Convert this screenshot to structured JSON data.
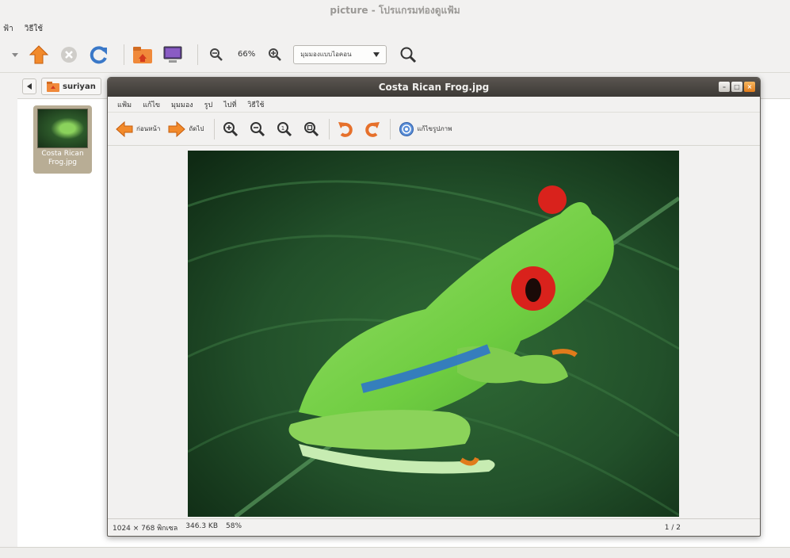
{
  "background_window": {
    "title": "picture - โปรแกรมท่องดูแฟ้ม",
    "menu": [
      "ฟ้า",
      "วิธีใช้"
    ],
    "zoom": "66%",
    "view_mode": "มุมมองแบบไอคอน",
    "path_button": "suriyan"
  },
  "files": [
    {
      "name": "Costa Rican Frog.jpg",
      "label_line1": "Costa Rican",
      "label_line2": "Frog.jpg"
    }
  ],
  "viewer": {
    "title": "Costa Rican Frog.jpg",
    "menu": [
      "แฟ้ม",
      "แก้ไข",
      "มุมมอง",
      "รูป",
      "ไปที่",
      "วิธีใช้"
    ],
    "toolbar": {
      "prev_label": "ก่อนหน้า",
      "next_label": "ถัดไป",
      "edit_label": "แก้ไขรูปภาพ"
    },
    "status": {
      "dimensions": "1024 × 768 พิกเซล",
      "size": "346.3 KB",
      "zoom": "58%",
      "position": "1 / 2"
    }
  },
  "colors": {
    "title_bar": "#4a4642",
    "accent_orange": "#e07b1b",
    "frog_green": "#7fd44a",
    "leaf_dark": "#1b3a1c"
  }
}
